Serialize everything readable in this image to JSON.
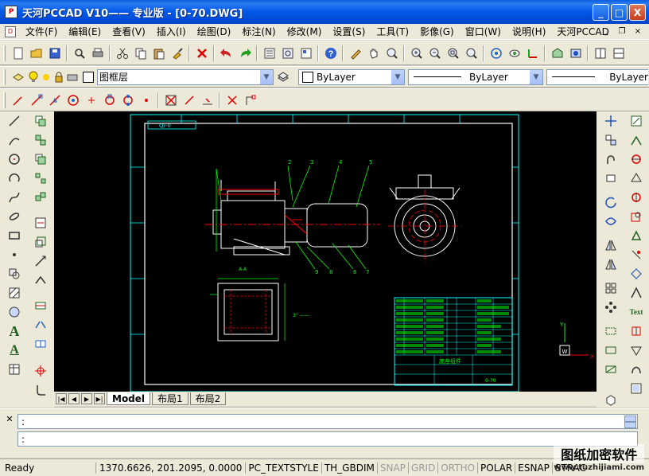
{
  "window": {
    "title": "天河PCCAD V10—— 专业版 - [0-70.DWG]",
    "app_icon": "pccad-app-icon",
    "minimize": "_",
    "maximize": "□",
    "close": "X"
  },
  "menu": {
    "items": [
      "文件(F)",
      "编辑(E)",
      "查看(V)",
      "插入(I)",
      "绘图(D)",
      "标注(N)",
      "修改(M)",
      "设置(S)",
      "工具(T)",
      "影像(G)",
      "窗口(W)",
      "说明(H)",
      "天河PCCAD"
    ],
    "mdi_min": "_",
    "mdi_restore": "❐",
    "mdi_close": "×"
  },
  "properties_bar": {
    "layer_name": "图框层",
    "color_value": "ByLayer",
    "linetype_value": "ByLayer",
    "lineweight_value": "ByLayer"
  },
  "layout_tabs": {
    "tabs": [
      "Model",
      "布局1",
      "布局2"
    ],
    "active": "Model"
  },
  "command": {
    "line1_prompt": ":",
    "line2_prompt": ":"
  },
  "status": {
    "ready": "Ready",
    "coords": "1370.6626, 201.2095, 0.0000",
    "items": [
      {
        "label": "PC_TEXTSTYLE",
        "on": true
      },
      {
        "label": "TH_GBDIM",
        "on": true
      },
      {
        "label": "SNAP",
        "on": false
      },
      {
        "label": "GRID",
        "on": false
      },
      {
        "label": "ORTHO",
        "on": false
      },
      {
        "label": "POLAR",
        "on": true
      },
      {
        "label": "ESNAP",
        "on": true
      },
      {
        "label": "STRAC",
        "on": true
      }
    ]
  },
  "drawing": {
    "title_block_name": "底座组件",
    "drawing_number": "0-70",
    "part_callouts": [
      "1",
      "2",
      "3",
      "4",
      "5",
      "6",
      "7",
      "8",
      "9"
    ],
    "section_label": "A-A",
    "note": "Q/-0",
    "ucs_x": "X",
    "ucs_y": "Y",
    "ucs_w": "W"
  },
  "watermark": {
    "text": "图纸加密软件",
    "url": "www.tuzhijiami.com"
  },
  "colors": {
    "title_bar": "#0058e6",
    "canvas_bg": "#000000",
    "frame": "#00ffff",
    "geometry": "#ffffff",
    "center_line": "#ff0000",
    "dimension": "#00ff00",
    "table_text": "#00ff00"
  }
}
